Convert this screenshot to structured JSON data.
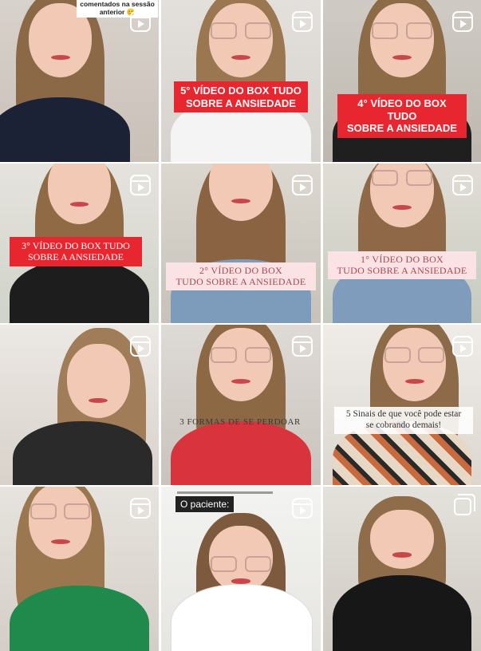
{
  "colors": {
    "caption_red": "#e8262f",
    "caption_pink": "#fbe3e5",
    "caption_pink_text": "#a8474e",
    "icon_white": "#ffffff"
  },
  "tiles": [
    {
      "icon": "reels-icon",
      "caption": "comentados na sessão anterior 😊"
    },
    {
      "icon": "reels-icon",
      "caption": "5° VÍDEO DO BOX TUDO\nSOBRE A ANSIEDADE"
    },
    {
      "icon": "reels-icon",
      "caption": "4° VÍDEO DO BOX TUDO\nSOBRE A ANSIEDADE"
    },
    {
      "icon": "reels-icon",
      "caption": "3° VÍDEO DO BOX TUDO\nSOBRE A ANSIEDADE"
    },
    {
      "icon": "reels-icon",
      "caption": "2° VÍDEO DO BOX\nTUDO SOBRE A ANSIEDADE"
    },
    {
      "icon": "reels-icon",
      "caption": "1° VÍDEO DO BOX\nTUDO SOBRE A ANSIEDADE"
    },
    {
      "icon": "reels-icon",
      "caption": ""
    },
    {
      "icon": "reels-icon",
      "caption": "3 FORMAS DE SE PERDOAR"
    },
    {
      "icon": "reels-icon",
      "caption": "5 Sinais de que você pode estar\nse cobrando demais!"
    },
    {
      "icon": "reels-icon",
      "caption": ""
    },
    {
      "icon": "reels-icon",
      "caption": "O paciente:"
    },
    {
      "icon": "carousel-icon",
      "caption": ""
    }
  ]
}
